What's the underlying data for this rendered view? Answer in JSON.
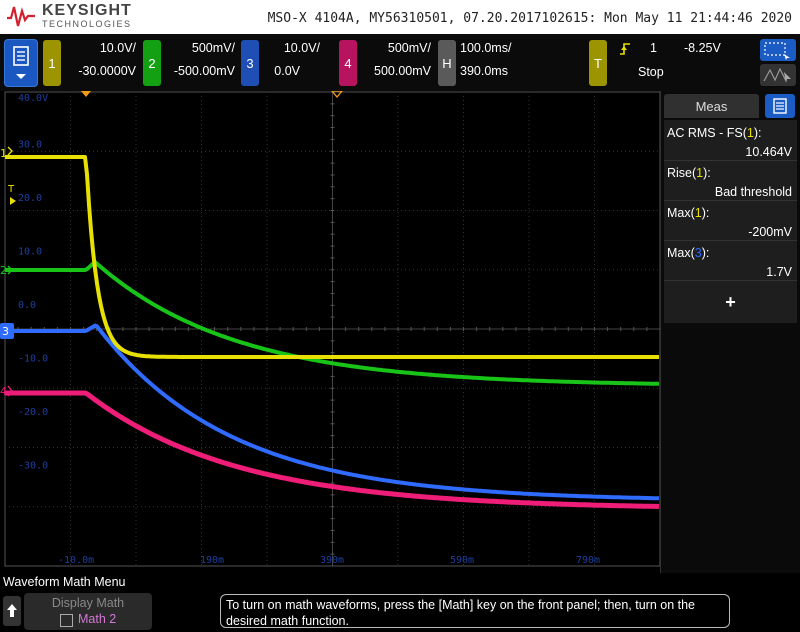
{
  "header": {
    "brand": "KEYSIGHT",
    "brand_sub": "TECHNOLOGIES",
    "info": "MSO-X 4104A, MY56310501, 07.20.2017102615: Mon May 11 21:44:46 2020"
  },
  "channels": [
    {
      "num": "1",
      "scale": "10.0V/",
      "offset": "-30.0000V",
      "color": "#e8e000"
    },
    {
      "num": "2",
      "scale": "500mV/",
      "offset": "-500.00mV",
      "color": "#19c418"
    },
    {
      "num": "3",
      "scale": "10.0V/",
      "offset": "0.0V",
      "color": "#2f6bff"
    },
    {
      "num": "4",
      "scale": "500mV/",
      "offset": "500.00mV",
      "color": "#ee1d78"
    }
  ],
  "horizontal": {
    "letter": "H",
    "scale": "100.0ms/",
    "delay": "390.0ms"
  },
  "trigger": {
    "letter": "T",
    "source": "1",
    "level": "-8.25V",
    "status": "Stop",
    "color": "#e8e000"
  },
  "graticule": {
    "y_labels": [
      "40.0V",
      "30.0",
      "20.0",
      "10.0",
      "0.0",
      "-10.0",
      "-20.0",
      "-30.0"
    ],
    "x_labels": [
      "-10.0m",
      "190m",
      "390m",
      "590m",
      "790m"
    ],
    "markers": {
      "ch1": "1",
      "trigger": "T",
      "ch2": "2",
      "ch3": "3",
      "ch4": "4"
    }
  },
  "measurements": {
    "tab_label": "Meas",
    "items": [
      {
        "label_prefix": "AC RMS - FS(",
        "label_src": "1",
        "label_suffix": "):",
        "src_color": "#e8e000",
        "value": "10.464V"
      },
      {
        "label_prefix": "Rise(",
        "label_src": "1",
        "label_suffix": "):",
        "src_color": "#e8e000",
        "value": "Bad threshold"
      },
      {
        "label_prefix": "Max(",
        "label_src": "1",
        "label_suffix": "):",
        "src_color": "#e8e000",
        "value": "-200mV"
      },
      {
        "label_prefix": "Max(",
        "label_src": "3",
        "label_suffix": "):",
        "src_color": "#2f6bff",
        "value": "1.7V"
      }
    ],
    "add_label": "+"
  },
  "bottom": {
    "menu_title": "Waveform Math Menu",
    "display_math_label": "Display Math",
    "math2_label": "Math 2",
    "tip": "To turn on math waveforms, press the [Math] key on the front panel; then, turn on the desired math function."
  }
}
